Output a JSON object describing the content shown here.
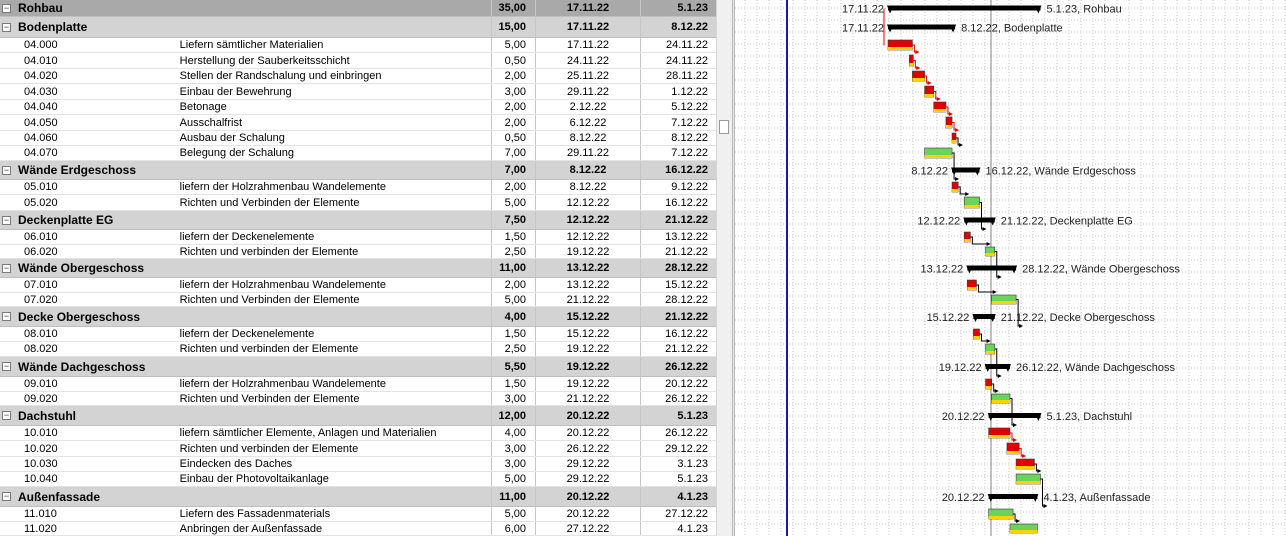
{
  "rows": [
    {
      "type": "summary",
      "level": 0,
      "toggle": "−",
      "name": "Rohbau",
      "dur": "35,00",
      "start": "17.11.22",
      "end": "5.1.23"
    },
    {
      "type": "summary",
      "level": 1,
      "toggle": "−",
      "name": "Bodenplatte",
      "dur": "15,00",
      "start": "17.11.22",
      "end": "8.12.22"
    },
    {
      "type": "task",
      "id": "04.000",
      "name": "Liefern sämtlicher Materialien",
      "dur": "5,00",
      "start": "17.11.22",
      "end": "24.11.22"
    },
    {
      "type": "task",
      "id": "04.010",
      "name": "Herstellung der Sauberkeitsschicht",
      "dur": "0,50",
      "start": "24.11.22",
      "end": "24.11.22"
    },
    {
      "type": "task",
      "id": "04.020",
      "name": "Stellen der Randschalung und einbringen",
      "dur": "2,00",
      "start": "25.11.22",
      "end": "28.11.22"
    },
    {
      "type": "task",
      "id": "04.030",
      "name": "Einbau der Bewehrung",
      "dur": "3,00",
      "start": "29.11.22",
      "end": "1.12.22"
    },
    {
      "type": "task",
      "id": "04.040",
      "name": "Betonage",
      "dur": "2,00",
      "start": "2.12.22",
      "end": "5.12.22"
    },
    {
      "type": "task",
      "id": "04.050",
      "name": "Ausschalfrist",
      "dur": "2,00",
      "start": "6.12.22",
      "end": "7.12.22"
    },
    {
      "type": "task",
      "id": "04.060",
      "name": "Ausbau der Schalung",
      "dur": "0,50",
      "start": "8.12.22",
      "end": "8.12.22"
    },
    {
      "type": "task",
      "id": "04.070",
      "name": "Belegung der Schalung",
      "dur": "7,00",
      "start": "29.11.22",
      "end": "7.12.22"
    },
    {
      "type": "summary",
      "level": 1,
      "toggle": "−",
      "name": "Wände Erdgeschoss",
      "dur": "7,00",
      "start": "8.12.22",
      "end": "16.12.22"
    },
    {
      "type": "task",
      "id": "05.010",
      "name": "liefern der Holzrahmenbau Wandelemente",
      "dur": "2,00",
      "start": "8.12.22",
      "end": "9.12.22"
    },
    {
      "type": "task",
      "id": "05.020",
      "name": "Richten und Verbinden der Elemente",
      "dur": "5,00",
      "start": "12.12.22",
      "end": "16.12.22"
    },
    {
      "type": "summary",
      "level": 1,
      "toggle": "−",
      "name": "Deckenplatte EG",
      "dur": "7,50",
      "start": "12.12.22",
      "end": "21.12.22"
    },
    {
      "type": "task",
      "id": "06.010",
      "name": "liefern der Deckenelemente",
      "dur": "1,50",
      "start": "12.12.22",
      "end": "13.12.22"
    },
    {
      "type": "task",
      "id": "06.020",
      "name": "Richten und verbinden der Elemente",
      "dur": "2,50",
      "start": "19.12.22",
      "end": "21.12.22"
    },
    {
      "type": "summary",
      "level": 1,
      "toggle": "−",
      "name": "Wände Obergeschoss",
      "dur": "11,00",
      "start": "13.12.22",
      "end": "28.12.22"
    },
    {
      "type": "task",
      "id": "07.010",
      "name": "liefern der Holzrahmenbau Wandelemente",
      "dur": "2,00",
      "start": "13.12.22",
      "end": "15.12.22"
    },
    {
      "type": "task",
      "id": "07.020",
      "name": "Richten und Verbinden der Elemente",
      "dur": "5,00",
      "start": "21.12.22",
      "end": "28.12.22"
    },
    {
      "type": "summary",
      "level": 1,
      "toggle": "−",
      "name": "Decke Obergeschoss",
      "dur": "4,00",
      "start": "15.12.22",
      "end": "21.12.22"
    },
    {
      "type": "task",
      "id": "08.010",
      "name": "liefern der Deckenelemente",
      "dur": "1,50",
      "start": "15.12.22",
      "end": "16.12.22"
    },
    {
      "type": "task",
      "id": "08.020",
      "name": "Richten und verbinden der Elemente",
      "dur": "2,50",
      "start": "19.12.22",
      "end": "21.12.22"
    },
    {
      "type": "summary",
      "level": 1,
      "toggle": "−",
      "name": "Wände Dachgeschoss",
      "dur": "5,50",
      "start": "19.12.22",
      "end": "26.12.22"
    },
    {
      "type": "task",
      "id": "09.010",
      "name": "liefern der Holzrahmenbau Wandelemente",
      "dur": "1,50",
      "start": "19.12.22",
      "end": "20.12.22"
    },
    {
      "type": "task",
      "id": "09.020",
      "name": "Richten und Verbinden der Elemente",
      "dur": "3,00",
      "start": "21.12.22",
      "end": "26.12.22"
    },
    {
      "type": "summary",
      "level": 1,
      "toggle": "−",
      "name": "Dachstuhl",
      "dur": "12,00",
      "start": "20.12.22",
      "end": "5.1.23"
    },
    {
      "type": "task",
      "id": "10.010",
      "name": "liefern sämtlicher Elemente, Anlagen und Materialien",
      "dur": "4,00",
      "start": "20.12.22",
      "end": "26.12.22"
    },
    {
      "type": "task",
      "id": "10.020",
      "name": "Richten und verbinden der Elemente",
      "dur": "3,00",
      "start": "26.12.22",
      "end": "29.12.22"
    },
    {
      "type": "task",
      "id": "10.030",
      "name": "Eindecken des Daches",
      "dur": "3,00",
      "start": "29.12.22",
      "end": "3.1.23"
    },
    {
      "type": "task",
      "id": "10.040",
      "name": "Einbau der Photovoltaikanlage",
      "dur": "5,00",
      "start": "29.12.22",
      "end": "5.1.23"
    },
    {
      "type": "summary",
      "level": 1,
      "toggle": "−",
      "name": "Außenfassade",
      "dur": "11,00",
      "start": "20.12.22",
      "end": "4.1.23"
    },
    {
      "type": "task",
      "id": "11.010",
      "name": "Liefern des Fassadenmaterials",
      "dur": "5,00",
      "start": "20.12.22",
      "end": "27.12.22"
    },
    {
      "type": "task",
      "id": "11.020",
      "name": "Anbringen der Außenfassade",
      "dur": "6,00",
      "start": "27.12.22",
      "end": "4.1.23"
    }
  ],
  "gantt_labels": {
    "0": {
      "left": "17.11.22",
      "right": "5.1.23, Rohbau"
    },
    "1": {
      "left": "17.11.22",
      "right": "8.12.22, Bodenplatte"
    },
    "10": {
      "left": "8.12.22",
      "right": "16.12.22, Wände Erdgeschoss"
    },
    "13": {
      "left": "12.12.22",
      "right": "21.12.22, Deckenplatte EG"
    },
    "16": {
      "left": "13.12.22",
      "right": "28.12.22, Wände Obergeschoss"
    },
    "19": {
      "left": "15.12.22",
      "right": "21.12.22, Decke Obergeschoss"
    },
    "22": {
      "left": "19.12.22",
      "right": "26.12.22, Wände Dachgeschoss"
    },
    "25": {
      "left": "20.12.22",
      "right": "5.1.23, Dachstuhl"
    },
    "30": {
      "left": "20.12.22",
      "right": "4.1.23, Außenfassade"
    }
  },
  "critical_tasks": [
    "04.000",
    "04.010",
    "04.020",
    "04.030",
    "04.040",
    "04.050",
    "04.060",
    "05.010",
    "06.010",
    "07.010",
    "08.010",
    "09.010",
    "10.010",
    "10.020",
    "10.030"
  ],
  "colors": {
    "summary_bar": "#000000",
    "critical_bar": "#e00000",
    "task_bar": "#6ad35a",
    "progress": "#ffd200",
    "critical_link": "#e00000",
    "link": "#000000",
    "today_line": "#1a1aa0",
    "grid": "#c8c8c8"
  }
}
